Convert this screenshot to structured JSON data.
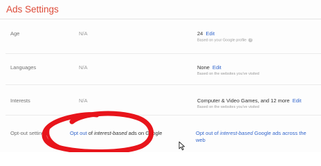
{
  "page": {
    "title": "Ads Settings",
    "accent_color": "#dd4b39",
    "link_color": "#3366cc"
  },
  "rows": {
    "age": {
      "label": "Age",
      "na": "N/A",
      "value": "24",
      "edit": "Edit",
      "sub": "Based on your Google profile",
      "help_icon": "question-mark-icon",
      "help_text": "?"
    },
    "languages": {
      "label": "Languages",
      "na": "N/A",
      "value": "None",
      "edit": "Edit",
      "sub": "Based on the websites you've visited"
    },
    "interests": {
      "label": "Interests",
      "na": "N/A",
      "value": "Computer & Video Games, and 12 more",
      "edit": "Edit",
      "sub": "Based on the websites you've visited"
    },
    "optout": {
      "label": "Opt-out settings",
      "google_link": {
        "pre": "Opt out",
        "mid": " of ",
        "emph": "interest-based",
        "post": " ads on Google"
      },
      "web_link": {
        "line1_pre": "Opt out of ",
        "line1_emph": "interest-based",
        "line1_post": " Google ads across the",
        "line2": "web"
      }
    }
  },
  "annotation": {
    "type": "hand-drawn circle",
    "color": "#e8141b"
  },
  "cursor_icon": "mouse-pointer-icon"
}
